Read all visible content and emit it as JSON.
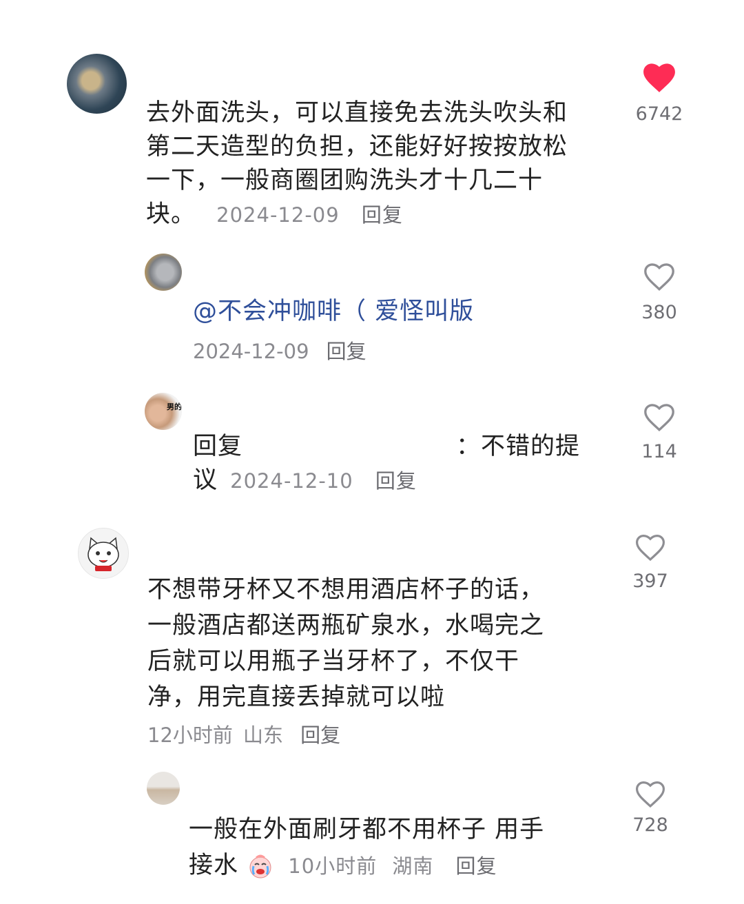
{
  "comments": [
    {
      "text_lines": [
        "去外面洗头，可以直接免去洗头吹头和",
        "第二天造型的负担，还能好好按按放松",
        "一下，一般商圈团购洗头才十几二十"
      ],
      "last_line": "块。",
      "date": "2024-12-09",
      "reply_label": "回复",
      "likes": "6742",
      "liked": true
    },
    {
      "mention": "@不会冲咖啡（ 爱怪叫版",
      "date": "2024-12-09",
      "reply_label": "回复",
      "likes": "380",
      "avatar_text": ""
    },
    {
      "prefix": "回复",
      "colon_text": "：不错的提",
      "last_line": "议",
      "date": "2024-12-10",
      "reply_label": "回复",
      "likes": "114",
      "avatar_text": "男的"
    },
    {
      "text_lines": [
        "不想带牙杯又不想用酒店杯子的话，",
        "一般酒店都送两瓶矿泉水，水喝完之",
        "后就可以用瓶子当牙杯了，不仅干",
        "净，用完直接丢掉就可以啦"
      ],
      "time": "12小时前",
      "location": "山东",
      "reply_label": "回复",
      "likes": "397"
    },
    {
      "text_line": "一般在外面刷牙都不用杯子 用手",
      "last_line": "接水",
      "time": "10小时前",
      "location": "湖南",
      "reply_label": "回复",
      "likes": "728"
    }
  ],
  "colors": {
    "liked_heart": "#fe2c55",
    "outline_heart": "#8e8e93",
    "mention": "#2f4f9a"
  }
}
